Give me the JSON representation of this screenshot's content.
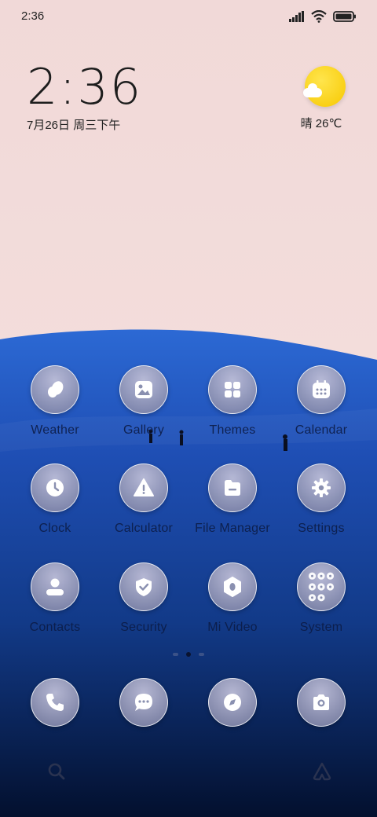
{
  "status_bar": {
    "time": "2:36",
    "icons": [
      "signal-icon",
      "wifi-icon",
      "battery-icon"
    ]
  },
  "clock_widget": {
    "time": "2:36",
    "date": "7月26日 周三下午"
  },
  "weather_widget": {
    "icon": "sunny-cloud-icon",
    "summary": "晴 26℃"
  },
  "apps": [
    {
      "label": "Weather",
      "icon": "weather-icon"
    },
    {
      "label": "Gallery",
      "icon": "gallery-icon"
    },
    {
      "label": "Themes",
      "icon": "themes-icon"
    },
    {
      "label": "Calendar",
      "icon": "calendar-icon"
    },
    {
      "label": "Clock",
      "icon": "clock-icon"
    },
    {
      "label": "Calculator",
      "icon": "calculator-icon"
    },
    {
      "label": "File Manager",
      "icon": "folder-icon"
    },
    {
      "label": "Settings",
      "icon": "gear-icon"
    },
    {
      "label": "Contacts",
      "icon": "contacts-icon"
    },
    {
      "label": "Security",
      "icon": "shield-icon"
    },
    {
      "label": "Mi Video",
      "icon": "video-icon"
    },
    {
      "label": "System",
      "icon": "folder-grid-icon"
    }
  ],
  "page_indicator": {
    "pages": 3,
    "current": 2
  },
  "dock": [
    {
      "icon": "phone-icon"
    },
    {
      "icon": "messages-icon"
    },
    {
      "icon": "browser-icon"
    },
    {
      "icon": "camera-icon"
    }
  ],
  "bottom_bar": {
    "icons": [
      "search-icon",
      "assistant-icon"
    ]
  },
  "colors": {
    "sky": "#f3dcdc",
    "sea_top": "#2a66d0",
    "sea_bottom": "#04143a",
    "sun": "#f7c800"
  }
}
